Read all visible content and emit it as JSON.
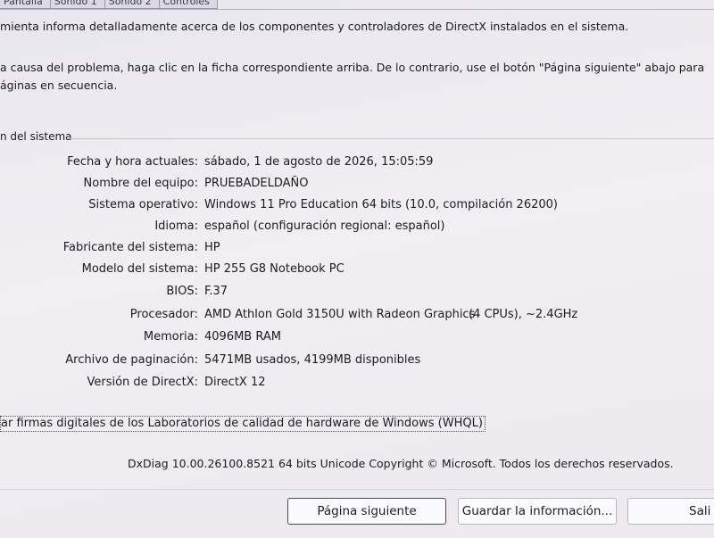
{
  "tabs": [
    "Pantalla",
    "Sonido 1",
    "Sonido 2",
    "Controles"
  ],
  "intro": "mienta informa detalladamente acerca de los componentes y controladores de DirectX instalados en el sistema.",
  "help_line1": "a causa del problema, haga clic en la ficha correspondiente arriba. De lo contrario, use el botón \"Página siguiente\" abajo para",
  "help_line2": "áginas en secuencia.",
  "section_title": "n del sistema",
  "system_info": [
    {
      "label": "Fecha y hora actuales:",
      "value": "sábado, 1 de agosto de 2026, 15:05:59"
    },
    {
      "label": "Nombre del equipo:",
      "value": "PRUEBADELDAÑO"
    },
    {
      "label": "Sistema operativo:",
      "value": "Windows 11 Pro Education 64 bits (10.0, compilación 26200)"
    },
    {
      "label": "Idioma:",
      "value": "español (configuración regional: español)"
    },
    {
      "label": "Fabricante del sistema:",
      "value": "HP"
    },
    {
      "label": "Modelo del sistema:",
      "value": "HP 255 G8 Notebook PC"
    },
    {
      "label": "BIOS:",
      "value": "F.37"
    },
    {
      "label": "Procesador:",
      "value": "AMD Athlon Gold 3150U with Radeon Graphics",
      "value_extra": "(4 CPUs), ~2.4GHz"
    },
    {
      "label": "Memoria:",
      "value": "4096MB RAM"
    },
    {
      "label": "Archivo de paginación:",
      "value": "5471MB usados, 4199MB disponibles"
    },
    {
      "label": "Versión de DirectX:",
      "value": "DirectX 12"
    }
  ],
  "whql_checkbox_label": "ar firmas digitales de los Laboratorios de calidad de hardware de Windows (WHQL)",
  "version_line": "DxDiag 10.00.26100.8521 64 bits Unicode  Copyright © Microsoft. Todos los derechos reservados.",
  "buttons": {
    "next": "Página siguiente",
    "save": "Guardar la información...",
    "exit": "Sali"
  }
}
